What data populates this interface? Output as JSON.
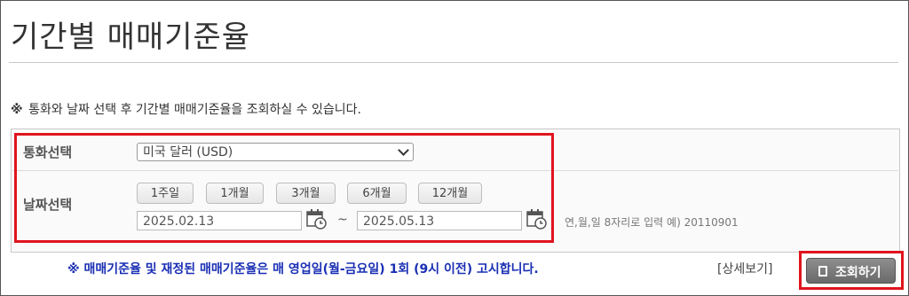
{
  "page": {
    "title": "기간별 매매기준율"
  },
  "notice": {
    "mark": "※",
    "text": "통화와 날짜 선택 후 기간별 매매기준율을 조회하실 수 있습니다."
  },
  "currency": {
    "label": "통화선택",
    "selected": "미국 달러 (USD)"
  },
  "date": {
    "label": "날짜선택",
    "periods": [
      "1주일",
      "1개월",
      "3개월",
      "6개월",
      "12개월"
    ],
    "start": "2025.02.13",
    "separator": "~",
    "end": "2025.05.13",
    "hint": "연,월,일 8자리로 입력 예) 20110901"
  },
  "footer": {
    "note": "※ 매매기준율 및 재정된 매매기준율은 매 영업일(월-금요일) 1회 (9시 이전) 고시합니다.",
    "detail": "[상세보기]",
    "search_label": "조회하기"
  },
  "colors": {
    "highlight": "#e0141e",
    "note_blue": "#1a2fb4"
  }
}
